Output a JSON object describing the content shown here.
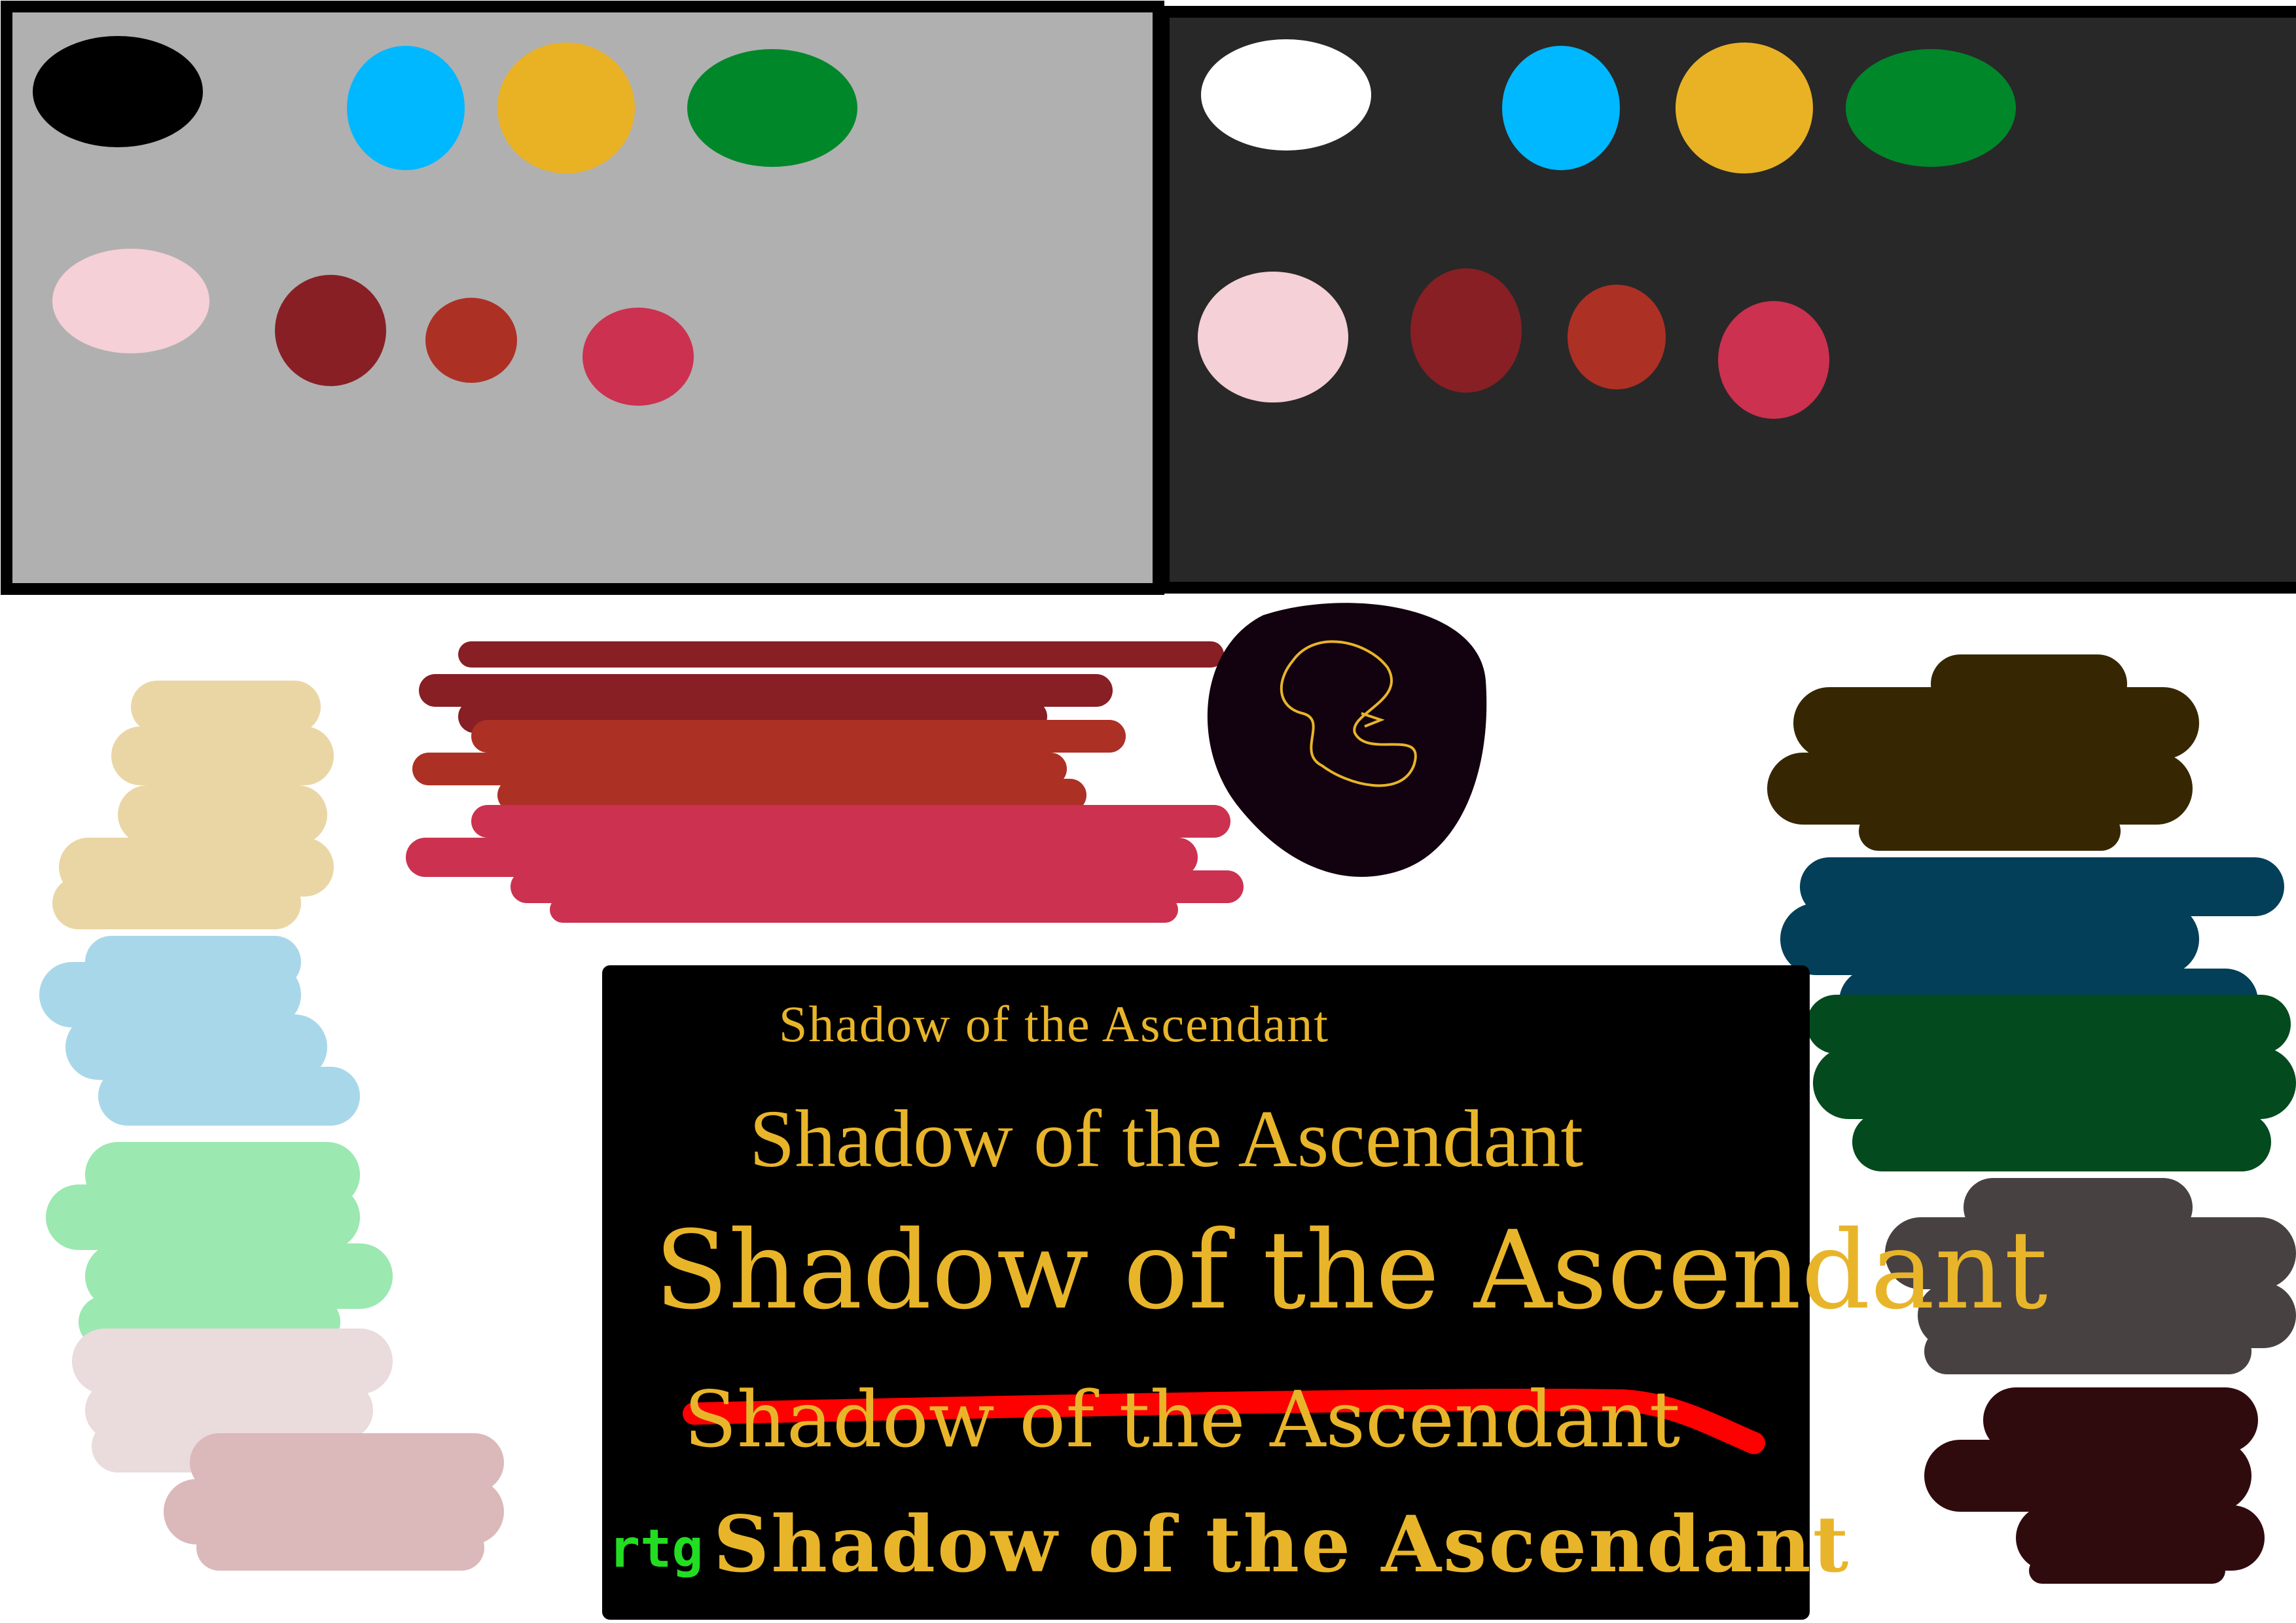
{
  "palette_light": {
    "background": "#b0b0b0",
    "row1": [
      "#000000",
      "#00b8ff",
      "#e9b225",
      "#00872a"
    ],
    "row2": [
      "#f5d0d6",
      "#871f25",
      "#ad3025",
      "#cc3150"
    ]
  },
  "palette_dark": {
    "background": "#282828",
    "row1": [
      "#ffffff",
      "#00b8ff",
      "#e9b225",
      "#00872a"
    ],
    "row2": [
      "#f5d0d6",
      "#871f25",
      "#ad3025",
      "#cc3150"
    ]
  },
  "left_swatches": [
    "#ead6a5",
    "#a9d7ea",
    "#9be8b0",
    "#eadbdc",
    "#dbb8ba"
  ],
  "center_stripes": [
    "#871f25",
    "#ad3025",
    "#cc3150"
  ],
  "orb_color": "#12010e",
  "right_swatches": [
    "#362702",
    "#033f58",
    "#034a1e",
    "#484142",
    "#300b0e"
  ],
  "font_panel": {
    "background": "#000000",
    "text_color": "#e8b52a",
    "strike_color": "#ff0000",
    "samples": [
      "Shadow of the Ascendant",
      "Shadow of the Ascendant",
      "Shadow of the Ascendant",
      "Shadow of the Ascendant",
      "Shadow of the Ascendant"
    ],
    "signature": "rtg"
  }
}
